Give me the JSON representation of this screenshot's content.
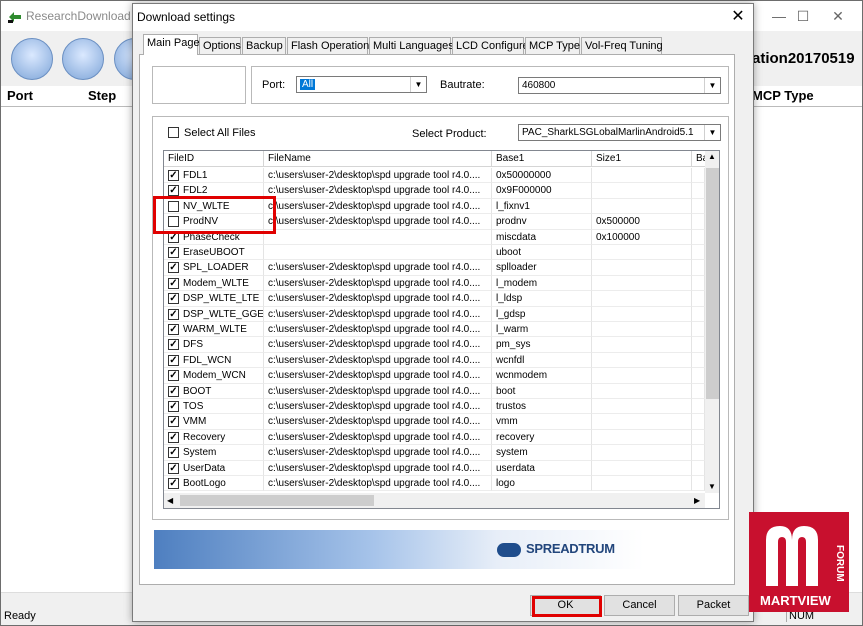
{
  "background_window": {
    "title": "ResearchDownload - R",
    "session_text": "ation20170519",
    "columns": [
      "Port",
      "Step",
      "MCP Type"
    ],
    "status_ready": "Ready",
    "status_num": "NUM"
  },
  "dialog": {
    "title": "Download settings",
    "tabs": [
      "Main Page",
      "Options",
      "Backup",
      "Flash Operations",
      "Multi Languages",
      "LCD Configure",
      "MCP Type",
      "Vol-Freq Tuning"
    ],
    "active_tab": "Main Page",
    "port": {
      "label": "Port:",
      "value": "All"
    },
    "baudrate": {
      "label": "Bautrate:",
      "value": "460800"
    },
    "select_all_label": "Select All Files",
    "select_product": {
      "label": "Select Product:",
      "value": "PAC_SharkLSGLobalMarlinAndroid5.1"
    },
    "grid": {
      "headers": [
        "FileID",
        "FileName",
        "Base1",
        "Size1",
        "Ba"
      ],
      "rows": [
        {
          "id": "FDL1",
          "checked": true,
          "file": "c:\\users\\user-2\\desktop\\spd upgrade tool r4.0....",
          "base": "0x50000000",
          "size": ""
        },
        {
          "id": "FDL2",
          "checked": true,
          "file": "c:\\users\\user-2\\desktop\\spd upgrade tool r4.0....",
          "base": "0x9F000000",
          "size": ""
        },
        {
          "id": "NV_WLTE",
          "checked": false,
          "file": "c:\\users\\user-2\\desktop\\spd upgrade tool r4.0....",
          "base": "l_fixnv1",
          "size": ""
        },
        {
          "id": "ProdNV",
          "checked": false,
          "file": "c:\\users\\user-2\\desktop\\spd upgrade tool r4.0....",
          "base": "prodnv",
          "size": "0x500000"
        },
        {
          "id": "PhaseCheck",
          "checked": true,
          "file": "",
          "base": "miscdata",
          "size": "0x100000"
        },
        {
          "id": "EraseUBOOT",
          "checked": true,
          "file": "",
          "base": "uboot",
          "size": ""
        },
        {
          "id": "SPL_LOADER",
          "checked": true,
          "file": "c:\\users\\user-2\\desktop\\spd upgrade tool r4.0....",
          "base": "splloader",
          "size": ""
        },
        {
          "id": "Modem_WLTE",
          "checked": true,
          "file": "c:\\users\\user-2\\desktop\\spd upgrade tool r4.0....",
          "base": "l_modem",
          "size": ""
        },
        {
          "id": "DSP_WLTE_LTE",
          "checked": true,
          "file": "c:\\users\\user-2\\desktop\\spd upgrade tool r4.0....",
          "base": "l_ldsp",
          "size": ""
        },
        {
          "id": "DSP_WLTE_GGE",
          "checked": true,
          "file": "c:\\users\\user-2\\desktop\\spd upgrade tool r4.0....",
          "base": "l_gdsp",
          "size": ""
        },
        {
          "id": "WARM_WLTE",
          "checked": true,
          "file": "c:\\users\\user-2\\desktop\\spd upgrade tool r4.0....",
          "base": "l_warm",
          "size": ""
        },
        {
          "id": "DFS",
          "checked": true,
          "file": "c:\\users\\user-2\\desktop\\spd upgrade tool r4.0....",
          "base": "pm_sys",
          "size": ""
        },
        {
          "id": "FDL_WCN",
          "checked": true,
          "file": "c:\\users\\user-2\\desktop\\spd upgrade tool r4.0....",
          "base": "wcnfdl",
          "size": ""
        },
        {
          "id": "Modem_WCN",
          "checked": true,
          "file": "c:\\users\\user-2\\desktop\\spd upgrade tool r4.0....",
          "base": "wcnmodem",
          "size": ""
        },
        {
          "id": "BOOT",
          "checked": true,
          "file": "c:\\users\\user-2\\desktop\\spd upgrade tool r4.0....",
          "base": "boot",
          "size": ""
        },
        {
          "id": "TOS",
          "checked": true,
          "file": "c:\\users\\user-2\\desktop\\spd upgrade tool r4.0....",
          "base": "trustos",
          "size": ""
        },
        {
          "id": "VMM",
          "checked": true,
          "file": "c:\\users\\user-2\\desktop\\spd upgrade tool r4.0....",
          "base": "vmm",
          "size": ""
        },
        {
          "id": "Recovery",
          "checked": true,
          "file": "c:\\users\\user-2\\desktop\\spd upgrade tool r4.0....",
          "base": "recovery",
          "size": ""
        },
        {
          "id": "System",
          "checked": true,
          "file": "c:\\users\\user-2\\desktop\\spd upgrade tool r4.0....",
          "base": "system",
          "size": ""
        },
        {
          "id": "UserData",
          "checked": true,
          "file": "c:\\users\\user-2\\desktop\\spd upgrade tool r4.0....",
          "base": "userdata",
          "size": ""
        },
        {
          "id": "BootLogo",
          "checked": true,
          "file": "c:\\users\\user-2\\desktop\\spd upgrade tool r4.0....",
          "base": "logo",
          "size": ""
        }
      ]
    },
    "banner_logo": "SPREADTRUM",
    "buttons": {
      "ok": "OK",
      "cancel": "Cancel",
      "packet": "Packet"
    }
  },
  "watermark": {
    "brand": "MARTVIEW",
    "forum": "FORUM"
  },
  "colors": {
    "highlight": "#e00000",
    "selection": "#0078d7",
    "watermark": "#c8102e"
  }
}
